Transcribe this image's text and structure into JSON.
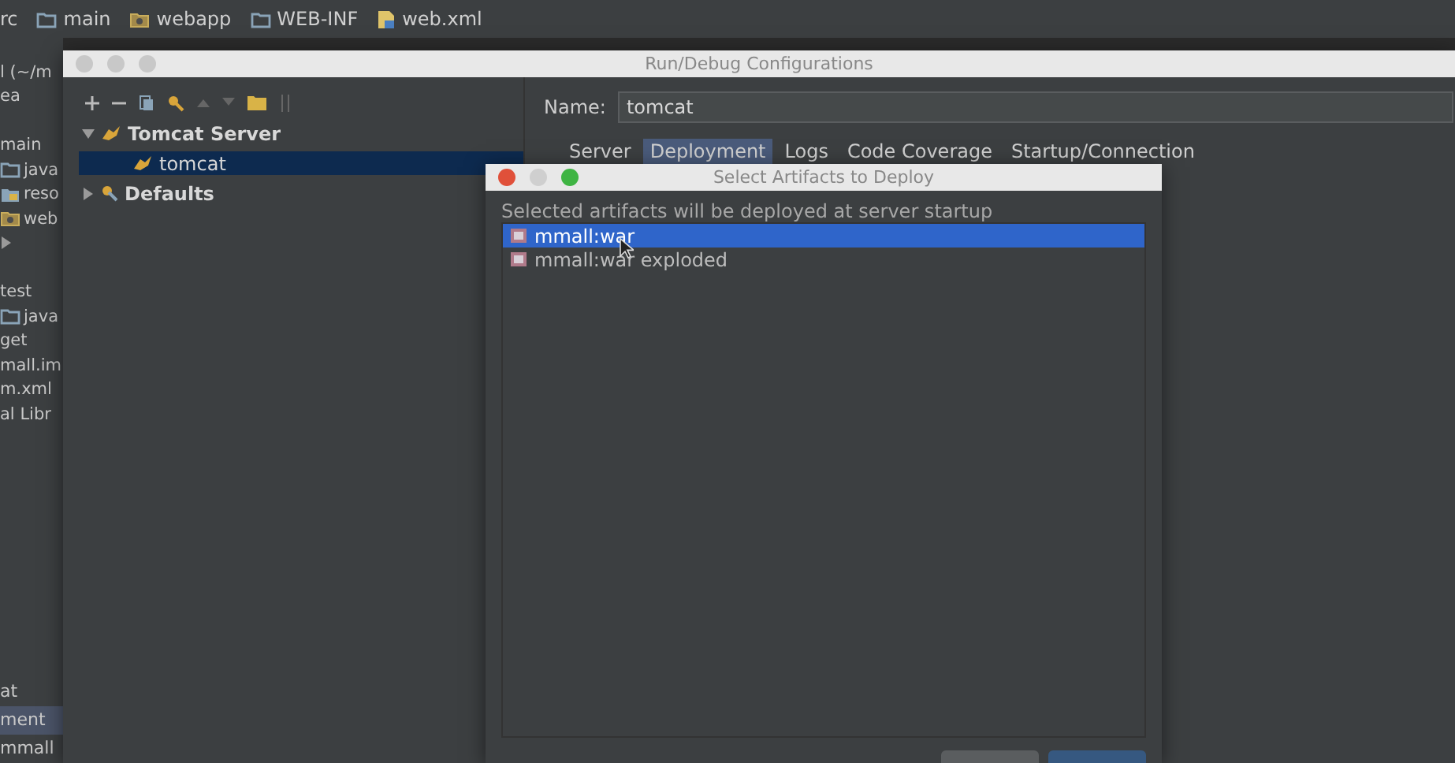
{
  "breadcrumbs": [
    {
      "label": "rc",
      "kind": "plain"
    },
    {
      "label": "main",
      "kind": "folder"
    },
    {
      "label": "webapp",
      "kind": "web"
    },
    {
      "label": "WEB-INF",
      "kind": "folder"
    },
    {
      "label": "web.xml",
      "kind": "xml"
    }
  ],
  "project_tree": [
    {
      "items": [
        {
          "label": "l (~/m",
          "kind": "plain"
        },
        {
          "label": "ea",
          "kind": "plain"
        }
      ]
    },
    {
      "items": [
        {
          "label": "main",
          "kind": "plain"
        },
        {
          "label": "java",
          "kind": "folder"
        },
        {
          "label": "reso",
          "kind": "resources"
        },
        {
          "label": "web",
          "kind": "web"
        },
        {
          "kind": "expander"
        }
      ]
    },
    {
      "items": [
        {
          "label": "test",
          "kind": "plain"
        },
        {
          "label": "java",
          "kind": "folder"
        },
        {
          "label": "get",
          "kind": "plain"
        },
        {
          "label": "mall.im",
          "kind": "plain"
        },
        {
          "label": "m.xml",
          "kind": "plain"
        },
        {
          "label": "al Libr",
          "kind": "plain"
        }
      ]
    }
  ],
  "bottom_panel": [
    {
      "label": "at",
      "selected": false
    },
    {
      "label": "ment",
      "selected": true
    },
    {
      "label": "mmall",
      "selected": false
    }
  ],
  "run_dialog": {
    "title": "Run/Debug Configurations",
    "tree": [
      {
        "label": "Tomcat Server",
        "kind": "server",
        "expanded": true,
        "children": [
          {
            "label": "tomcat",
            "selected": true
          }
        ]
      },
      {
        "label": "Defaults",
        "kind": "defaults",
        "expanded": false
      }
    ],
    "name_label": "Name:",
    "name_value": "tomcat",
    "tabs": [
      {
        "label": "Server",
        "selected": false
      },
      {
        "label": "Deployment",
        "selected": true
      },
      {
        "label": "Logs",
        "selected": false
      },
      {
        "label": "Code Coverage",
        "selected": false
      },
      {
        "label": "Startup/Connection",
        "selected": false
      }
    ]
  },
  "artifacts_dialog": {
    "title": "Select Artifacts to Deploy",
    "hint": "Selected artifacts will be deployed at server startup",
    "items": [
      {
        "label": "mmall:war",
        "selected": true
      },
      {
        "label": "mmall:war exploded",
        "selected": false
      }
    ]
  }
}
